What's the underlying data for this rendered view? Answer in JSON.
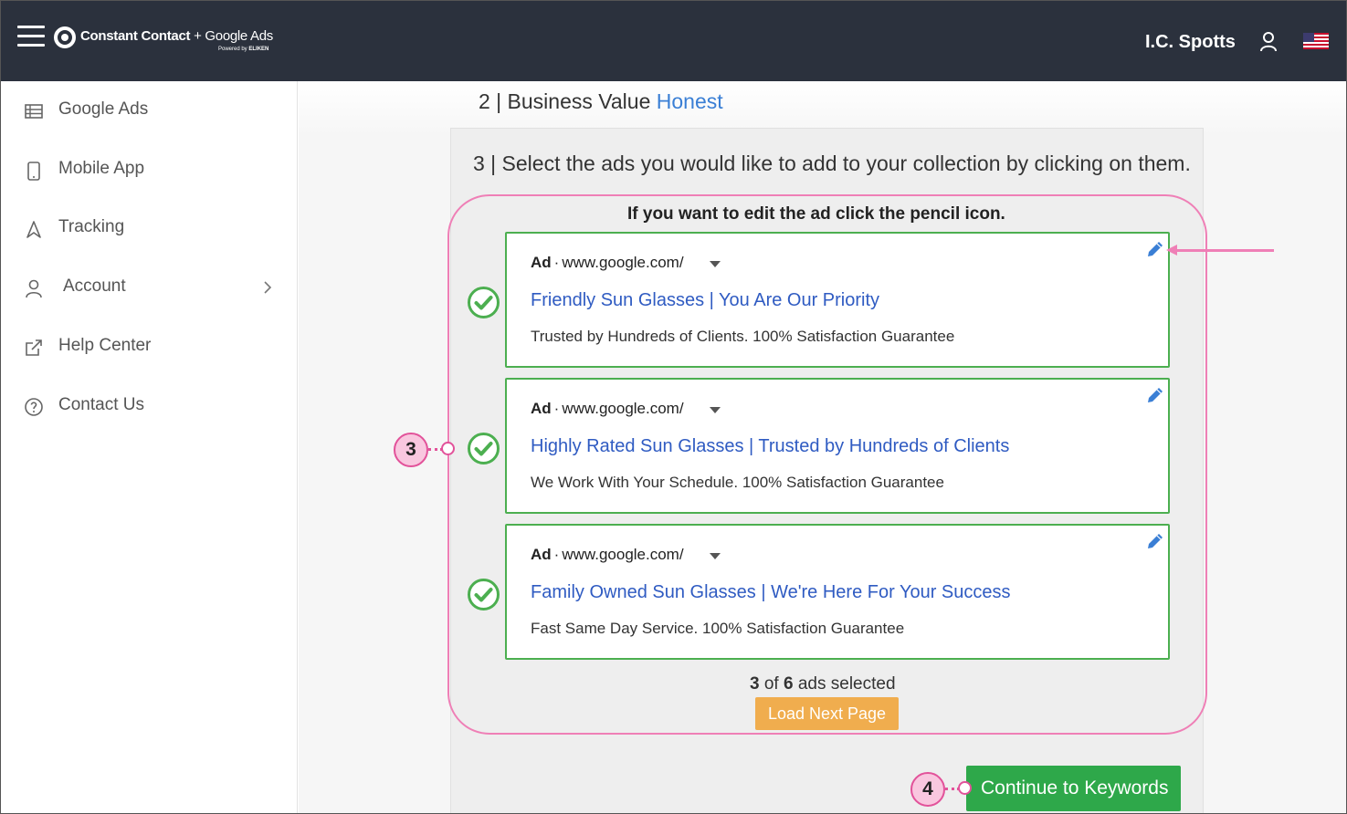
{
  "header": {
    "brand": "Constant Contact",
    "brand_plus": "+ Google Ads",
    "powered_by": "Powered by",
    "powered_brand": "ELIKEN",
    "username": "I.C. Spotts"
  },
  "sidebar": {
    "items": [
      {
        "label": "Google Ads",
        "icon": "table-icon"
      },
      {
        "label": "Mobile App",
        "icon": "phone-icon"
      },
      {
        "label": "Tracking",
        "icon": "navigation-icon"
      },
      {
        "label": "Account",
        "icon": "user-icon"
      },
      {
        "label": "Help Center",
        "icon": "external-link-icon"
      },
      {
        "label": "Contact Us",
        "icon": "question-icon"
      }
    ]
  },
  "main": {
    "step2_prefix": "2 | Business Value",
    "step2_value": "Honest",
    "step3": "3 | Select the ads you would like to add to your collection by clicking on them.",
    "edit_hint": "If you want to edit the ad click the pencil icon.",
    "ads": [
      {
        "label": "Ad",
        "url": "www.google.com/",
        "title": "Friendly Sun Glasses | You Are Our Priority",
        "description": "Trusted by Hundreds of Clients. 100% Satisfaction Guarantee",
        "selected": true
      },
      {
        "label": "Ad",
        "url": "www.google.com/",
        "title": "Highly Rated Sun Glasses | Trusted by Hundreds of Clients",
        "description": "We Work With Your Schedule. 100% Satisfaction Guarantee",
        "selected": true
      },
      {
        "label": "Ad",
        "url": "www.google.com/",
        "title": "Family Owned Sun Glasses | We're Here For Your Success",
        "description": "Fast Same Day Service. 100% Satisfaction Guarantee",
        "selected": true
      }
    ],
    "selected_count": "3",
    "count_of": "of",
    "total_count": "6",
    "count_suffix": "ads selected",
    "load_next": "Load Next Page",
    "continue": "Continue to Keywords"
  },
  "annotations": {
    "badge_3": "3",
    "badge_4": "4"
  },
  "colors": {
    "topbar": "#2b313d",
    "link": "#2f5bc2",
    "selected_border": "#4caf50",
    "load_button": "#f0ad4e",
    "continue_button": "#2ea84a",
    "callout": "#e2529a"
  }
}
